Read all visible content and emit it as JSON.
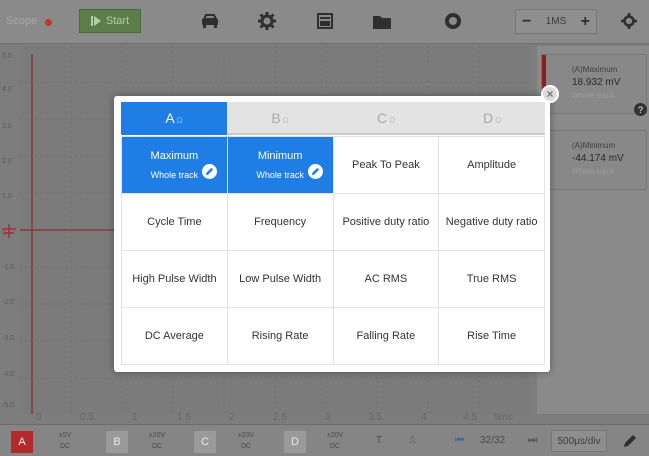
{
  "toolbar": {
    "title": "Scope",
    "start_label": "Start",
    "timebase": {
      "minus": "−",
      "value": "1MS",
      "plus": "+"
    }
  },
  "plot": {
    "y_labels": [
      "5.0",
      "4.0",
      "3.0",
      "2.0",
      "1.0",
      "0",
      "-1.0",
      "-2.0",
      "-3.0",
      "-4.0",
      "-5.0"
    ],
    "x_labels": [
      "0",
      "0.5",
      "1",
      "1.5",
      "2",
      "2.5",
      "3",
      "3.5",
      "4",
      "4.5",
      "5ms"
    ]
  },
  "right_panel": {
    "cards": [
      {
        "title": "(A)Maximum",
        "value": "18.932 mV",
        "range": "Whole track"
      },
      {
        "title": "(A)Minimum",
        "value": "-44.174 mV",
        "range": "Whole track"
      }
    ]
  },
  "dialog": {
    "tabs": [
      {
        "label": "A",
        "sub": "Ω"
      },
      {
        "label": "B",
        "sub": "Ω"
      },
      {
        "label": "C",
        "sub": "Ω"
      },
      {
        "label": "D",
        "sub": "Ω"
      }
    ],
    "selected_sub": "Whole track",
    "items": [
      "Maximum",
      "Minimum",
      "Peak To Peak",
      "Amplitude",
      "Cycle Time",
      "Frequency",
      "Positive duty ratio",
      "Negative duty ratio",
      "High Pulse Width",
      "Low Pulse Width",
      "AC RMS",
      "True RMS",
      "DC Average",
      "Rising Rate",
      "Falling Rate",
      "Rise Time"
    ],
    "close_symbol": "×"
  },
  "bottom": {
    "channels": [
      {
        "label": "A",
        "range": "±5V",
        "coupling": "DC",
        "color": "#b22a2a"
      },
      {
        "label": "B",
        "range": "±20V",
        "coupling": "DC",
        "color": "#9a9a9a"
      },
      {
        "label": "C",
        "range": "±20V",
        "coupling": "DC",
        "color": "#9a9a9a"
      },
      {
        "label": "D",
        "range": "±20V",
        "coupling": "DC",
        "color": "#9a9a9a"
      }
    ],
    "trigger_t": "T",
    "trigger_edge": "⎍",
    "prev": "⏮",
    "page": "32/32",
    "next": "⏭",
    "time_div": "500μs/div"
  },
  "colors": {
    "accent": "#1f7de6",
    "trace": "#b02a2a",
    "start": "#5b7e4a"
  }
}
